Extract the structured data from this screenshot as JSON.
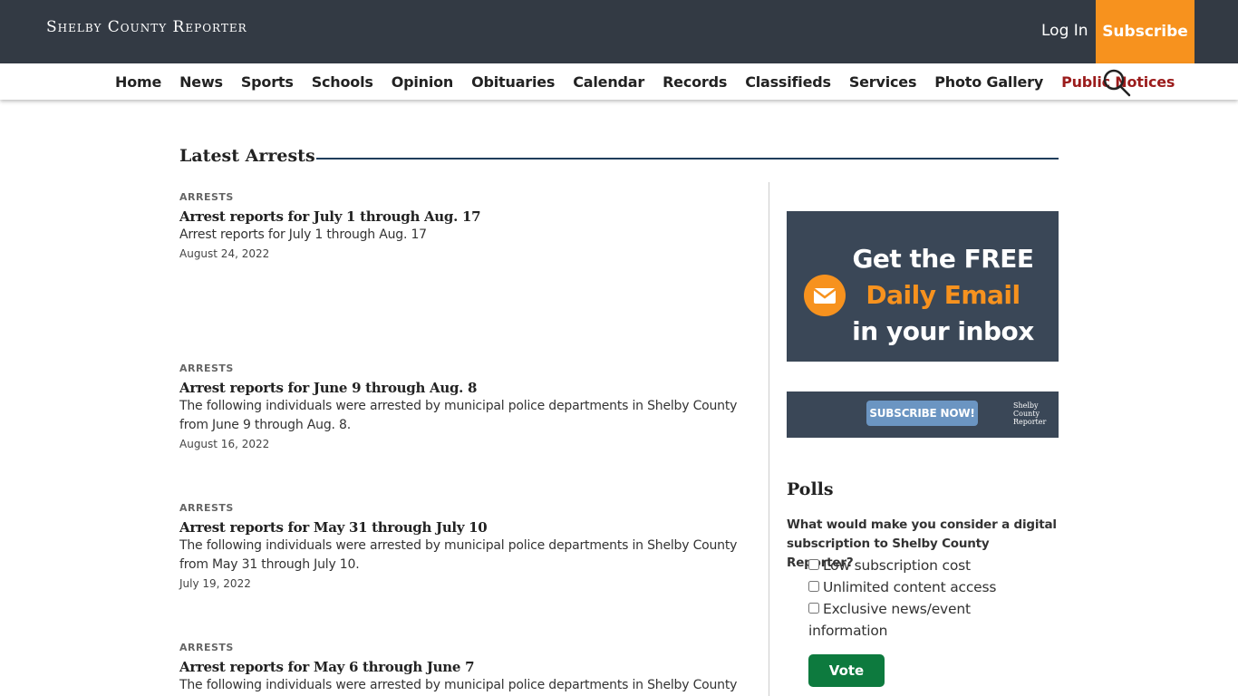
{
  "header": {
    "logo_text": "Shelby County Reporter",
    "login_label": "Log In",
    "subscribe_label": "Subscribe"
  },
  "nav": {
    "items": [
      "Home",
      "News",
      "Sports",
      "Schools",
      "Opinion",
      "Obituaries",
      "Calendar",
      "Records",
      "Classifieds",
      "Services",
      "Photo Gallery",
      "Public Notices"
    ]
  },
  "section": {
    "title": "Latest Arrests"
  },
  "articles": [
    {
      "category": "ARRESTS",
      "title": "Arrest reports for July 1 through Aug. 17",
      "desc": "Arrest reports for July 1 through Aug. 17",
      "date": "August 24, 2022"
    },
    {
      "category": "ARRESTS",
      "title": "Arrest reports for June 9 through Aug. 8",
      "desc": "The following individuals were arrested by municipal police departments in Shelby County from June 9 through Aug. 8.",
      "date": "August 16, 2022"
    },
    {
      "category": "ARRESTS",
      "title": "Arrest reports for May 31 through July 10",
      "desc": "The following individuals were arrested by municipal police departments in Shelby County from May 31 through July 10.",
      "date": "July 19, 2022"
    },
    {
      "category": "ARRESTS",
      "title": "Arrest reports for May 6 through June 7",
      "desc": "The following individuals were arrested by municipal police departments in Shelby County",
      "date": ""
    }
  ],
  "sidebar": {
    "email_ad": {
      "line1": "Get the FREE",
      "line2": "Daily Email",
      "line3": "in your inbox"
    },
    "subscribe_ad": {
      "button": "SUBSCRIBE NOW!",
      "logo": "Shelby County Reporter"
    },
    "polls": {
      "title": "Polls",
      "question": "What would make you consider a digital subscription to Shelby County Reporter?",
      "options": [
        "Low subscription cost",
        "Unlimited content access",
        "Exclusive news/event information"
      ],
      "vote_label": "Vote"
    }
  },
  "colors": {
    "header_bg": "#333a44",
    "accent_orange": "#f7921e",
    "public_notices": "#9b1c1c",
    "vote_green": "#0d7a3e",
    "rule_navy": "#1f3d5c"
  }
}
